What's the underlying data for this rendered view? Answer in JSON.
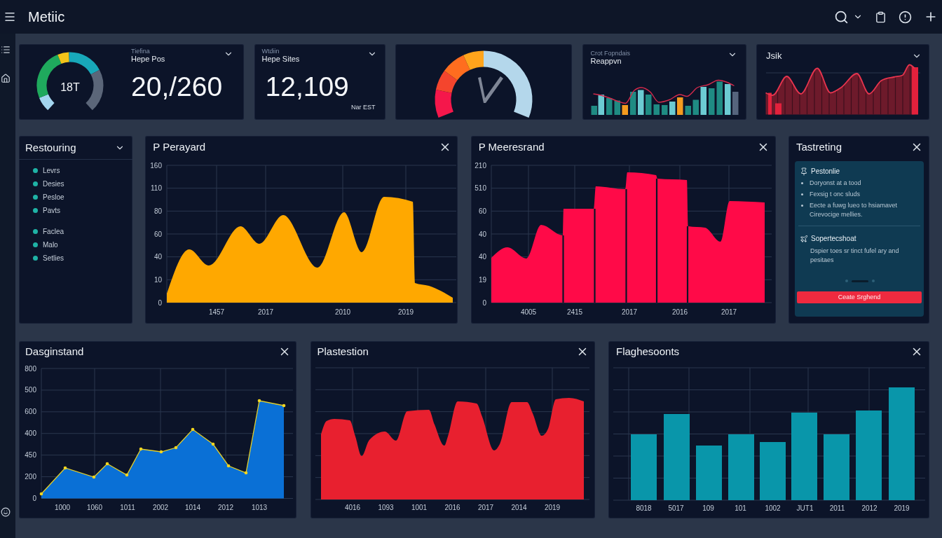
{
  "header": {
    "title": "Metiic"
  },
  "kpi_cards": [
    {
      "kind": "ring_stat",
      "gauge_label": "18T",
      "caption": "Tiefina",
      "title": "Hepe Pos",
      "value": "20,/260"
    },
    {
      "kind": "stat",
      "caption": "Wtdiin",
      "title": "Hepe Sites",
      "value": "12,109",
      "note": "Nar EST"
    },
    {
      "kind": "arc_gauge",
      "level": 0.5
    },
    {
      "kind": "bar_spark",
      "caption": "Crot Fopndais",
      "title": "Reappvn"
    },
    {
      "kind": "wave_spark",
      "title": "Jsik"
    }
  ],
  "list_panel": {
    "title": "Restouring",
    "groups": [
      {
        "items": [
          "Levrs",
          "Desies",
          "Pesloe",
          "Pavts"
        ]
      },
      {
        "items": [
          "Faclea",
          "Malo",
          "Setlies"
        ]
      }
    ]
  },
  "chart_panels": [
    {
      "kind": "peak_area",
      "title": "P Perayard",
      "y_labels": [
        "160",
        "110",
        "80",
        "60",
        "40",
        "10",
        "0"
      ],
      "x_labels": [
        "1457",
        "2017",
        "2010",
        "2019"
      ]
    },
    {
      "kind": "step_area",
      "title": "P Meeresrand",
      "y_labels": [
        "210",
        "510",
        "60",
        "40",
        "40",
        "19",
        "0"
      ],
      "x_labels": [
        "4005",
        "2415",
        "2017",
        "2016",
        "2017"
      ]
    }
  ],
  "info_panel": {
    "title": "Tastreting",
    "sections": [
      {
        "kind": "bullets",
        "heading": "Pestonlie",
        "items": [
          "Doryonst at a tood",
          "Fexsig t onc sluds",
          "Eecte a fuwg lueo to hsiamavet Cirevocige mellies."
        ]
      },
      {
        "kind": "text",
        "heading": "Sopertecshoat",
        "text": "Dspier toes sr tinct fufel ary and pesitaes"
      }
    ],
    "pager": [
      {
        "selected": false
      },
      {
        "selected": true
      },
      {
        "selected": false
      }
    ],
    "button": "Ceate Srghend"
  },
  "bottom_panels": [
    {
      "kind": "marker_area",
      "title": "Dasginstand",
      "y_labels": [
        "800",
        "500",
        "600",
        "400",
        "450",
        "200",
        "0"
      ],
      "x_labels": [
        "1000",
        "1060",
        "1011",
        "2002",
        "1014",
        "2012",
        "1013"
      ]
    },
    {
      "kind": "plateau_area",
      "title": "Plastestion",
      "x_labels": [
        "4016",
        "1093",
        "1001",
        "2016",
        "2017",
        "2014",
        "2019"
      ]
    },
    {
      "kind": "bars",
      "title": "Flaghesoonts",
      "x_labels": [
        "8018",
        "5017",
        "109",
        "101",
        "1002",
        "JUT1",
        "2011",
        "2012",
        "2019"
      ]
    }
  ]
}
